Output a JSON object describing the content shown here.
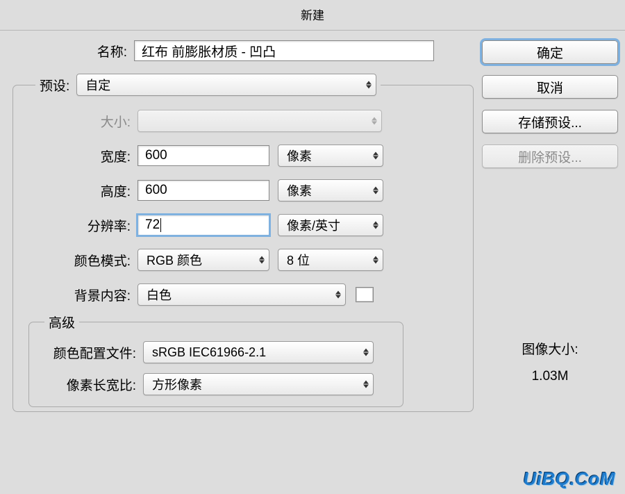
{
  "title": "新建",
  "name_row": {
    "label": "名称:",
    "value": "红布 前膨胀材质 - 凹凸"
  },
  "preset": {
    "label": "预设:",
    "value": "自定"
  },
  "size": {
    "label": "大小:",
    "value": ""
  },
  "width": {
    "label": "宽度:",
    "value": "600",
    "unit": "像素"
  },
  "height": {
    "label": "高度:",
    "value": "600",
    "unit": "像素"
  },
  "resolution": {
    "label": "分辨率:",
    "value": "72",
    "unit": "像素/英寸"
  },
  "color_mode": {
    "label": "颜色模式:",
    "value": "RGB 颜色",
    "depth": "8 位"
  },
  "background": {
    "label": "背景内容:",
    "value": "白色"
  },
  "advanced": {
    "legend": "高级",
    "profile": {
      "label": "颜色配置文件:",
      "value": "sRGB IEC61966-2.1"
    },
    "aspect": {
      "label": "像素长宽比:",
      "value": "方形像素"
    }
  },
  "buttons": {
    "ok": "确定",
    "cancel": "取消",
    "save_preset": "存储预设...",
    "delete_preset": "删除预设..."
  },
  "image_size": {
    "label": "图像大小:",
    "value": "1.03M"
  },
  "watermark": "UiBQ.CoM"
}
